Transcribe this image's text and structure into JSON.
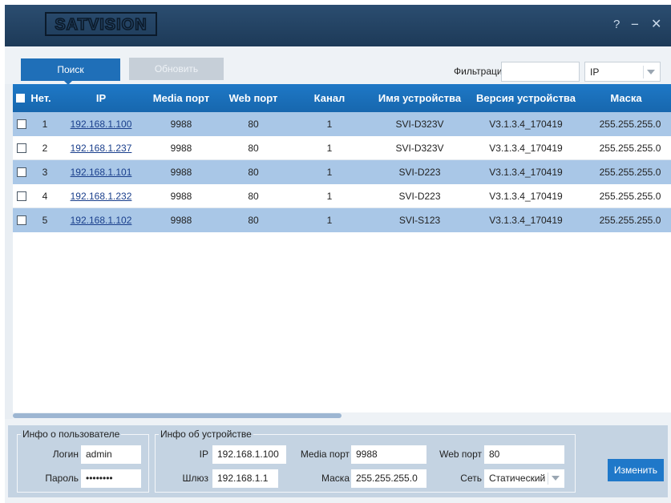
{
  "app": {
    "logo_text": "SATVISION",
    "help_glyph": "?",
    "minimize_glyph": "−",
    "close_glyph": "✕",
    "accent_color": "#1f6fb8",
    "header_color": "#1e78c6",
    "row_highlight_color": "#a9c7e7"
  },
  "toolbar": {
    "search_label": "Поиск",
    "refresh_label": "Обновить",
    "filter_label": "Фильтрация",
    "filter_value": "",
    "filter_type": "IP"
  },
  "table": {
    "columns": [
      "Нет.",
      "IP",
      "Media порт",
      "Web порт",
      "Канал",
      "Имя устройства",
      "Версия устройства",
      "Маска"
    ],
    "rows": [
      {
        "num": "1",
        "ip": "192.168.1.100",
        "media": "9988",
        "web": "80",
        "channel": "1",
        "name": "SVI-D323V",
        "version": "V3.1.3.4_170419",
        "mask": "255.255.255.0",
        "checked": false,
        "highlight": true
      },
      {
        "num": "2",
        "ip": "192.168.1.237",
        "media": "9988",
        "web": "80",
        "channel": "1",
        "name": "SVI-D323V",
        "version": "V3.1.3.4_170419",
        "mask": "255.255.255.0",
        "checked": false,
        "highlight": false
      },
      {
        "num": "3",
        "ip": "192.168.1.101",
        "media": "9988",
        "web": "80",
        "channel": "1",
        "name": "SVI-D223",
        "version": "V3.1.3.4_170419",
        "mask": "255.255.255.0",
        "checked": false,
        "highlight": true
      },
      {
        "num": "4",
        "ip": "192.168.1.232",
        "media": "9988",
        "web": "80",
        "channel": "1",
        "name": "SVI-D223",
        "version": "V3.1.3.4_170419",
        "mask": "255.255.255.0",
        "checked": false,
        "highlight": false
      },
      {
        "num": "5",
        "ip": "192.168.1.102",
        "media": "9988",
        "web": "80",
        "channel": "1",
        "name": "SVI-S123",
        "version": "V3.1.3.4_170419",
        "mask": "255.255.255.0",
        "checked": false,
        "highlight": true
      }
    ]
  },
  "user_info": {
    "legend": "Инфо о пользователе",
    "login_label": "Логин",
    "login_value": "admin",
    "password_label": "Пароль",
    "password_value": "••••••••"
  },
  "device_info": {
    "legend": "Инфо об устройстве",
    "ip_label": "IP",
    "ip_value": "192.168.1.100",
    "media_label": "Media порт",
    "media_value": "9988",
    "web_label": "Web порт",
    "web_value": "80",
    "gateway_label": "Шлюз",
    "gateway_value": "192.168.1.1",
    "mask_label": "Маска",
    "mask_value": "255.255.255.0",
    "net_label": "Сеть",
    "net_value": "Статический"
  },
  "actions": {
    "change_label": "Изменить"
  }
}
